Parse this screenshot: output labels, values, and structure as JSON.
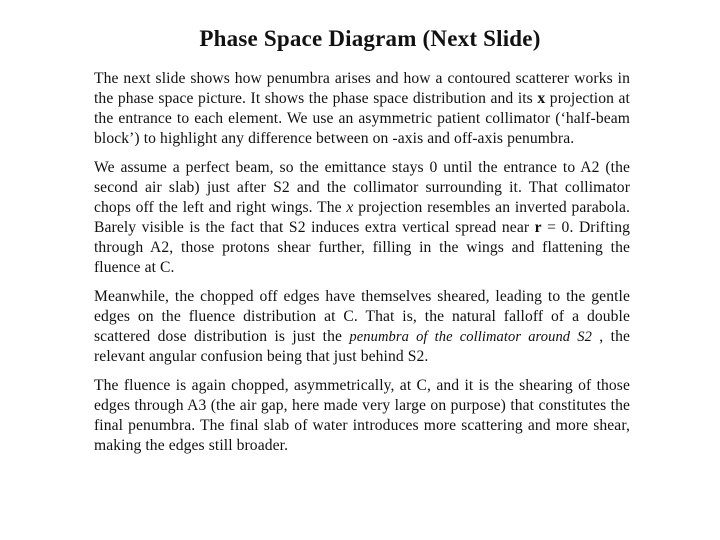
{
  "slide": {
    "title": "Phase Space Diagram (Next Slide)",
    "paragraphs": [
      {
        "p1_a": "The next slide shows how penumbra arises and how a contoured scatterer works in the phase space picture. It shows the phase space distribution and its ",
        "p1_b": "x",
        "p1_c": " projection at the entrance to each element. We use an asymmetric patient collimator (‘half-beam block’) to highlight any difference between on -axis and off-axis penumbra."
      },
      {
        "p2_a": "We assume a perfect beam, so the emittance stays 0 until the entrance to A2 (the second air slab) just after S2 and the collimator surrounding it. That collimator chops off the left and right wings. The ",
        "p2_b": "x",
        "p2_c": " projection resembles an inverted parabola. Barely visible is the fact that S2 induces extra vertical spread near ",
        "p2_d": "r",
        "p2_e": " = 0. Drifting through A2, those protons shear further, filling in the wings and flattening the fluence at C."
      },
      {
        "p3_a": "Meanwhile, the chopped off edges have themselves sheared, leading to the gentle edges on the fluence distribution at C. That is, the natural falloff of a double scattered dose distribution is just the ",
        "p3_b": "penumbra of the collimator around S2",
        "p3_c": " , the relevant angular confusion being that just behind S2."
      },
      {
        "p4": "The fluence is again chopped, asymmetrically, at C, and it is the shearing of those edges through A3 (the air gap, here made very large on purpose) that constitutes the final penumbra. The final slab of water introduces more scattering and more shear, making the edges still broader."
      }
    ]
  }
}
